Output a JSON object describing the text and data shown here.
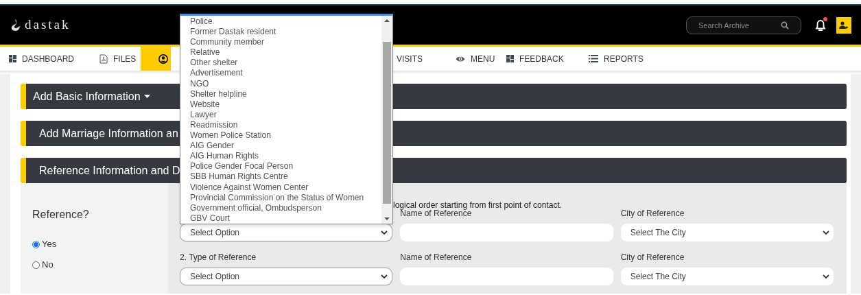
{
  "header": {
    "logo": "dastak",
    "search": {
      "placeholder": "Search Archive"
    },
    "notifications": {
      "unread": true
    }
  },
  "nav_tabs": [
    {
      "label": "DASHBOARD",
      "selected": false
    },
    {
      "label": "FILES",
      "selected": false
    },
    {
      "selected": true
    },
    {
      "label": "VISITS",
      "selected": false
    },
    {
      "label": "MENU",
      "selected": false
    },
    {
      "label": "FEEDBACK",
      "selected": false
    },
    {
      "label": "REPORTS",
      "selected": false
    }
  ],
  "sections": [
    {
      "title": "Add Basic Information",
      "caret": true
    },
    {
      "title": "Add Marriage Information an",
      "caret": false
    },
    {
      "title": "Reference Information and D",
      "caret": false
    }
  ],
  "reference": {
    "question": "Reference?",
    "options": [
      {
        "label": "Yes",
        "selected": true
      },
      {
        "label": "No",
        "selected": false
      }
    ],
    "instruction": "logical order starting from first point of contact.",
    "rows": [
      {
        "type_select": "Select Option",
        "name_label": "Name of Reference",
        "city_label": "City of Reference",
        "city_select": "Select The City"
      },
      {
        "type_label": "2. Type of Reference",
        "type_select": "Select Option",
        "name_label": "Name of Reference",
        "city_label": "City of Reference",
        "city_select": "Select The City"
      }
    ]
  },
  "open_dropdown": {
    "options": [
      "Police",
      "Former Dastak resident",
      "Community member",
      "Relative",
      "Other shelter",
      "Advertisement",
      "NGO",
      "Shelter helpline",
      "Website",
      "Lawyer",
      "Readmission",
      "Women Police Station",
      "AIG Gender",
      "AIG Human Rights",
      "Police Gender Focal Person",
      "SBB Human Rights Centre",
      "Violence Against Women Center",
      "Provincial Commission on the Status of Women",
      "Government official, Ombudsperson",
      "GBV Court"
    ]
  }
}
